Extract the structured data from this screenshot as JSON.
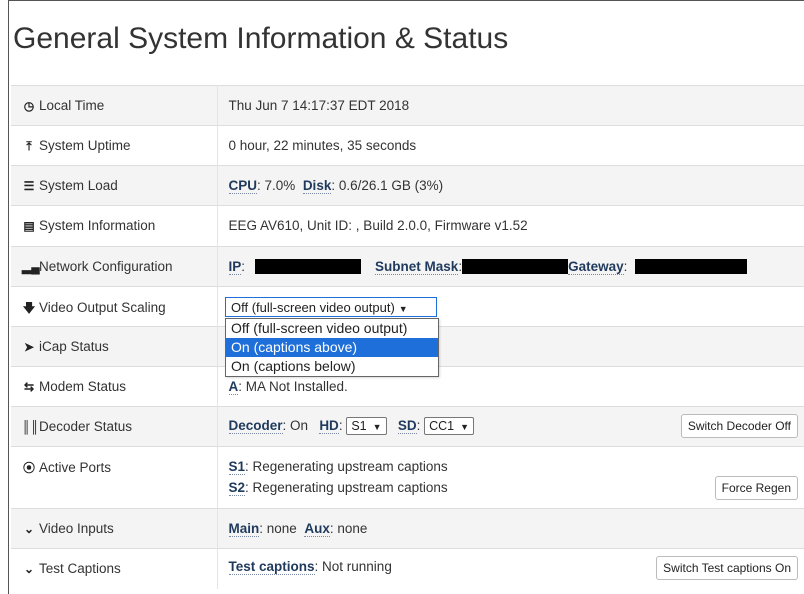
{
  "page": {
    "title": "General System Information & Status"
  },
  "rows": {
    "local_time": {
      "label": "Local Time",
      "icon": "clock-icon",
      "value": "Thu Jun 7 14:17:37 EDT 2018"
    },
    "uptime": {
      "label": "System Uptime",
      "icon": "arrow-up-circle-icon",
      "value": "0 hour, 22 minutes, 35 seconds"
    },
    "load": {
      "label": "System Load",
      "icon": "server-icon",
      "cpu_key": "CPU",
      "cpu_val": ": 7.0%",
      "disk_key": "Disk",
      "disk_val": ": 0.6/26.1 GB (3%)"
    },
    "info": {
      "label": "System Information",
      "icon": "laptop-icon",
      "value": "EEG AV610, Unit ID: , Build 2.0.0, Firmware v1.52"
    },
    "network": {
      "label": "Network Configuration",
      "icon": "signal-bars-icon",
      "ip_key": "IP",
      "mask_key": "Subnet Mask",
      "gw_key": "Gateway"
    },
    "scaling": {
      "label": "Video Output Scaling",
      "icon": "arrow-down-icon",
      "selected": "Off (full-screen video output)",
      "options": [
        "Off (full-screen video output)",
        "On (captions above)",
        "On (captions below)"
      ],
      "highlighted_index": 1
    },
    "icap": {
      "label": "iCap Status",
      "icon": "circle-icon"
    },
    "modem": {
      "label": "Modem Status",
      "icon": "retweet-icon",
      "a_key": "A",
      "a_val": ": MA Not Installed."
    },
    "decoder": {
      "label": "Decoder Status",
      "icon": "barcode-icon",
      "decoder_key": "Decoder",
      "decoder_val": ": On",
      "hd_key": "HD",
      "hd_value": "S1",
      "sd_key": "SD",
      "sd_value": "CC1",
      "button": "Switch Decoder Off"
    },
    "ports": {
      "label": "Active Ports",
      "icon": "circle-arrow-up-icon",
      "s1_key": "S1",
      "s1_val": ": Regenerating upstream captions",
      "s2_key": "S2",
      "s2_val": ": Regenerating upstream captions",
      "button": "Force Regen"
    },
    "video_inputs": {
      "label": "Video Inputs",
      "icon": "chevron-down-icon",
      "main_key": "Main",
      "main_val": ": none",
      "aux_key": "Aux",
      "aux_val": ": none"
    },
    "test_captions": {
      "label": "Test Captions",
      "icon": "chevron-down-icon",
      "key": "Test captions",
      "val": ": Not running",
      "button": "Switch Test captions On"
    }
  },
  "colors": {
    "accent": "#1e6fd9",
    "key_text": "#1f3a5c",
    "row_alt": "#f4f4f4"
  }
}
